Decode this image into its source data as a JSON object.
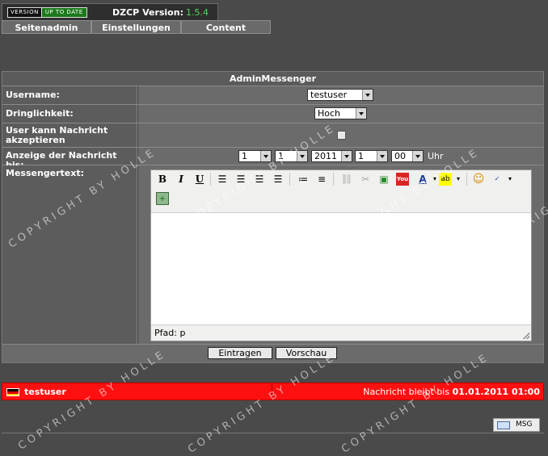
{
  "header": {
    "badge_version": "VERSION",
    "badge_status": "UP TO DATE",
    "product_label": "DZCP Version:",
    "product_version": "1.5.4"
  },
  "menu": [
    "Seitenadmin",
    "Einstellungen",
    "Content"
  ],
  "form": {
    "title": "AdminMessenger",
    "username_label": "Username:",
    "username_value": "testuser",
    "priority_label": "Dringlichkeit:",
    "priority_value": "Hoch",
    "accept_label": "User kann Nachricht akzeptieren",
    "accept_checked": false,
    "display_label": "Anzeige der Nachricht bis:",
    "day": "1",
    "month": "1",
    "year": "2011",
    "hour": "1",
    "minute": "00",
    "uhr": "Uhr",
    "text_label": "Messengertext:",
    "path_label": "Pfad:",
    "path_value": "p"
  },
  "buttons": {
    "submit": "Eintragen",
    "preview": "Vorschau"
  },
  "message_bar": {
    "user": "testuser",
    "info_prefix": "Nachricht bleibt bis",
    "info_date": "01.01.2011 01:00",
    "color": "#ff1010"
  },
  "msg_button": "MSG",
  "watermark": "COPYRIGHT BY HOLLE"
}
